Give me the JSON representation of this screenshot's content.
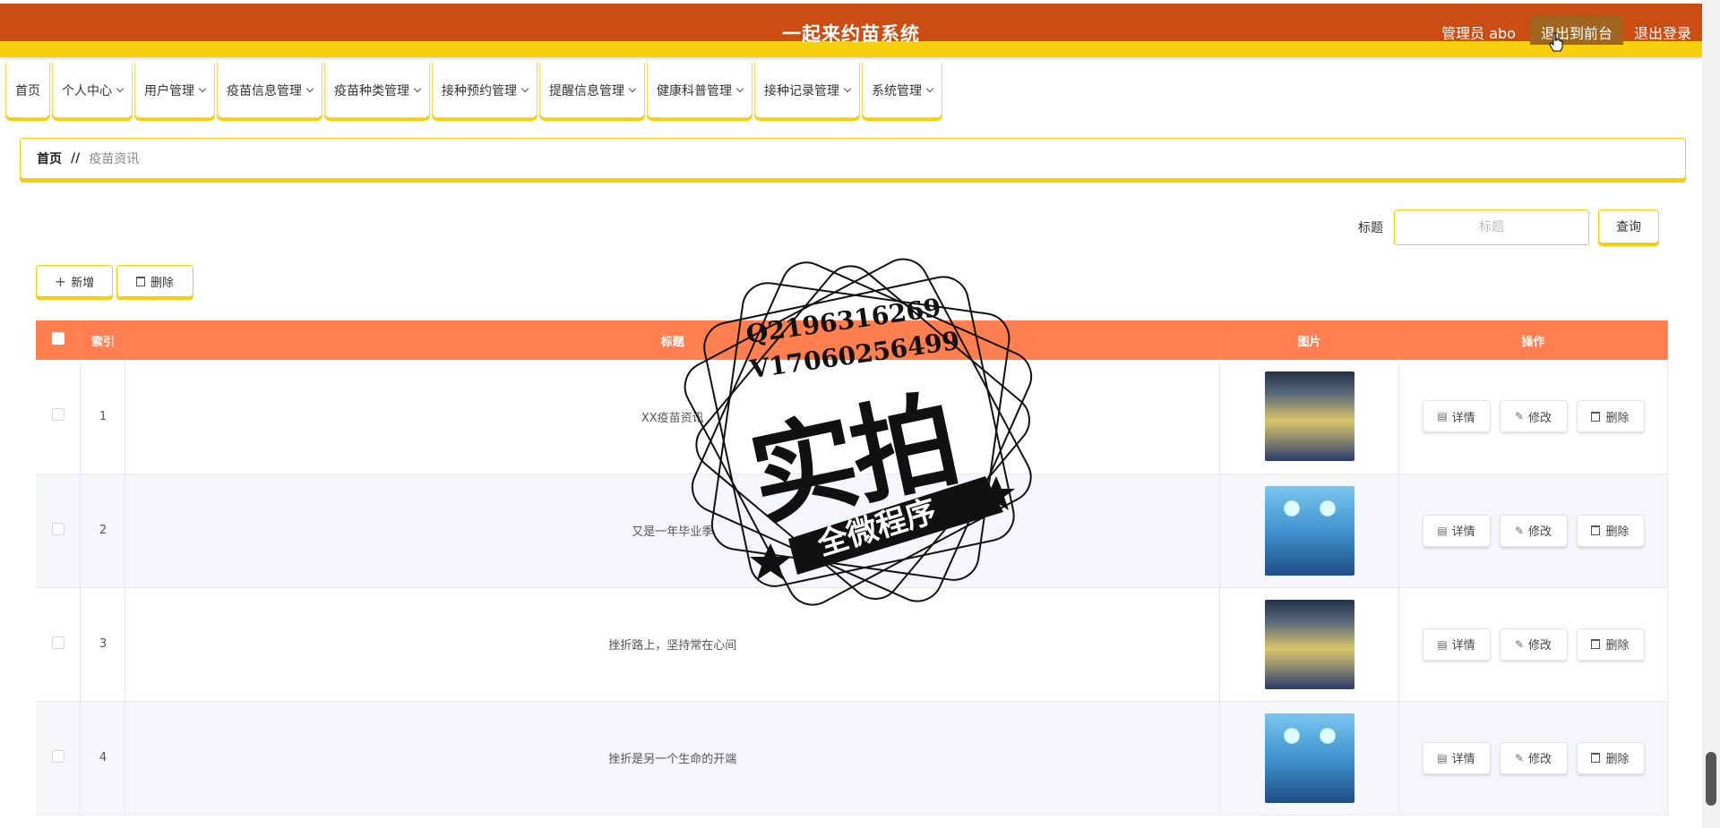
{
  "header": {
    "title": "一起来约苗系统",
    "user": "管理员 abo",
    "front_btn": "退出到前台",
    "logout_btn": "退出登录"
  },
  "nav": {
    "items": [
      "首页",
      "个人中心",
      "用户管理",
      "疫苗信息管理",
      "疫苗种类管理",
      "接种预约管理",
      "提醒信息管理",
      "健康科普管理",
      "接种记录管理",
      "系统管理"
    ]
  },
  "breadcrumb": {
    "home": "首页",
    "sep": "//",
    "current": "疫苗资讯"
  },
  "search": {
    "label": "标题",
    "placeholder": "标题",
    "button": "查询"
  },
  "actions": {
    "add": "新增",
    "delete": "删除"
  },
  "table": {
    "columns": [
      "索引",
      "标题",
      "图片",
      "操作"
    ],
    "rows": [
      {
        "index": "1",
        "title": "XX疫苗资讯",
        "image": "ward"
      },
      {
        "index": "2",
        "title": "又是一年毕业季",
        "image": "surgery"
      },
      {
        "index": "3",
        "title": "挫折路上，坚持常在心间",
        "image": "ward"
      },
      {
        "index": "4",
        "title": "挫折是另一个生命的开端",
        "image": "surgery"
      }
    ],
    "row_actions": {
      "detail": "详情",
      "edit": "修改",
      "delete": "删除"
    }
  },
  "watermark": {
    "line1": "Q2196316269",
    "line2": "V17060256499",
    "main": "实拍",
    "banner": "全微程序"
  },
  "colors": {
    "header": "#cc4d13",
    "accent": "#f6cf0c",
    "table_head": "#ff7f50"
  }
}
